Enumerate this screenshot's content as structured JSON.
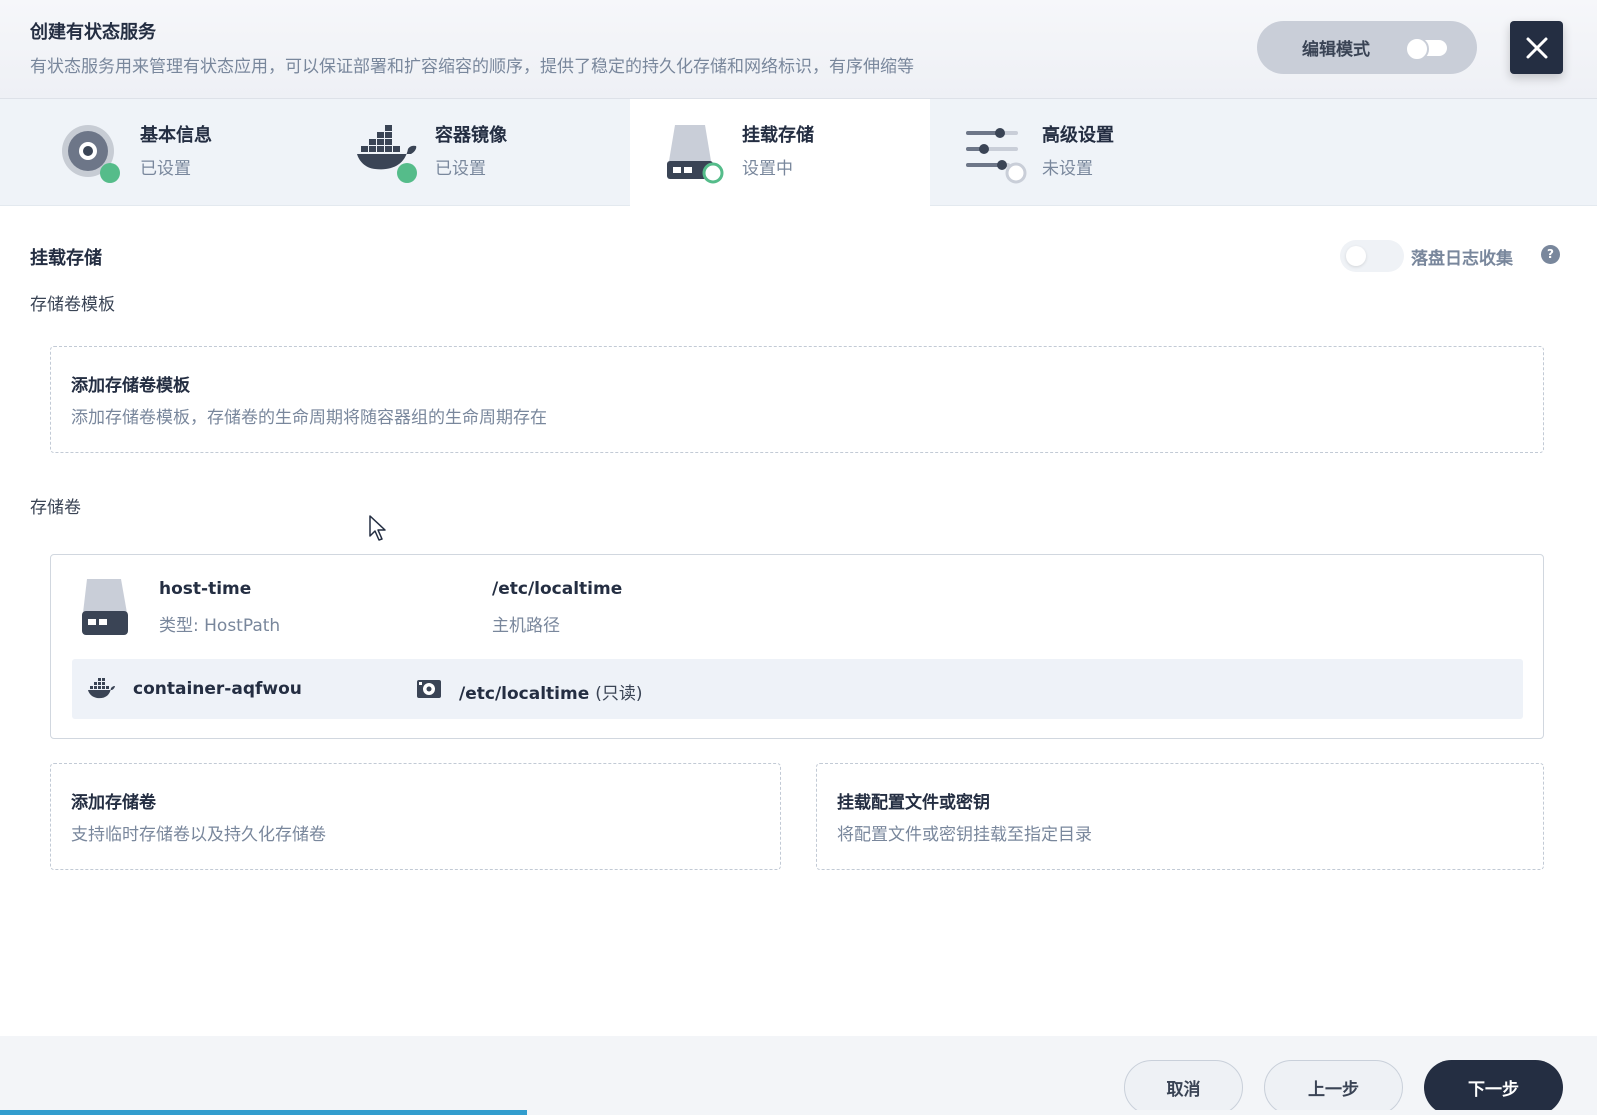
{
  "header": {
    "title": "创建有状态服务",
    "description": "有状态服务用来管理有状态应用，可以保证部署和扩容缩容的顺序，提供了稳定的持久化存储和网络标识，有序伸缩等",
    "edit_mode_label": "编辑模式",
    "edit_mode_enabled": false,
    "close_icon": "close-icon"
  },
  "steps": [
    {
      "title": "基本信息",
      "status": "已设置",
      "icon": "basic-info-icon",
      "state": "done"
    },
    {
      "title": "容器镜像",
      "status": "已设置",
      "icon": "docker-icon",
      "state": "done"
    },
    {
      "title": "挂载存储",
      "status": "设置中",
      "icon": "storage-disk-icon",
      "state": "active"
    },
    {
      "title": "高级设置",
      "status": "未设置",
      "icon": "sliders-icon",
      "state": "pending"
    }
  ],
  "main": {
    "section_title": "挂载存储",
    "log_collection_label": "落盘日志收集",
    "log_collection_enabled": false,
    "volume_template_label": "存储卷模板",
    "add_template": {
      "title": "添加存储卷模板",
      "description": "添加存储卷模板，存储卷的生命周期将随容器组的生命周期存在"
    },
    "volumes_label": "存储卷",
    "volume": {
      "name": "host-time",
      "type": "类型: HostPath",
      "path": "/etc/localtime",
      "path_label": "主机路径",
      "mount": {
        "container": "container-aqfwou",
        "mount_path": "/etc/localtime",
        "mode": "(只读)"
      }
    },
    "add_volume": {
      "title": "添加存储卷",
      "description": "支持临时存储卷以及持久化存储卷"
    },
    "mount_config": {
      "title": "挂载配置文件或密钥",
      "description": "将配置文件或密钥挂载至指定目录"
    }
  },
  "footer": {
    "cancel_label": "取消",
    "prev_label": "上一步",
    "next_label": "下一步",
    "progress": 0.33
  },
  "colors": {
    "primary_dark": "#242e42",
    "success": "#55bc8a",
    "muted": "#79879c",
    "progress": "#329dce"
  }
}
